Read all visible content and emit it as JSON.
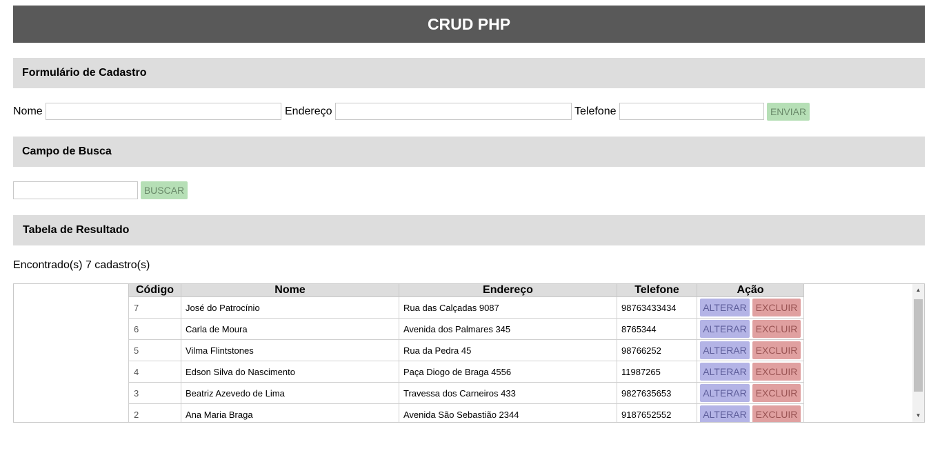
{
  "header": {
    "title": "CRUD PHP"
  },
  "form_section": {
    "title": "Formulário de Cadastro",
    "nome_label": "Nome",
    "nome_value": "",
    "endereco_label": "Endereço",
    "endereco_value": "",
    "telefone_label": "Telefone",
    "telefone_value": "",
    "submit_label": "ENVIAR"
  },
  "search_section": {
    "title": "Campo de Busca",
    "search_value": "",
    "search_button": "BUSCAR"
  },
  "results_section": {
    "title": "Tabela de Resultado",
    "count_text": "Encontrado(s) 7 cadastro(s)",
    "columns": [
      "Código",
      "Nome",
      "Endereço",
      "Telefone",
      "Ação"
    ],
    "rows": [
      {
        "codigo": "7",
        "nome": "José do Patrocínio",
        "endereco": "Rua das Calçadas 9087",
        "telefone": "98763433434",
        "alterar": "ALTERAR",
        "excluir": "EXCLUIR"
      },
      {
        "codigo": "6",
        "nome": "Carla de Moura",
        "endereco": "Avenida dos Palmares 345",
        "telefone": "8765344",
        "alterar": "ALTERAR",
        "excluir": "EXCLUIR"
      },
      {
        "codigo": "5",
        "nome": "Vilma Flintstones",
        "endereco": "Rua da Pedra 45",
        "telefone": "98766252",
        "alterar": "ALTERAR",
        "excluir": "EXCLUIR"
      },
      {
        "codigo": "4",
        "nome": "Edson Silva do Nascimento",
        "endereco": "Paça Diogo de Braga 4556",
        "telefone": "11987265",
        "alterar": "ALTERAR",
        "excluir": "EXCLUIR"
      },
      {
        "codigo": "3",
        "nome": "Beatriz Azevedo de Lima",
        "endereco": "Travessa dos Carneiros 433",
        "telefone": "9827635653",
        "alterar": "ALTERAR",
        "excluir": "EXCLUIR"
      },
      {
        "codigo": "2",
        "nome": "Ana Maria Braga",
        "endereco": "Avenida São Sebastião 2344",
        "telefone": "9187652552",
        "alterar": "ALTERAR",
        "excluir": "EXCLUIR"
      }
    ]
  },
  "colors": {
    "header_bg": "#595959",
    "section_bg": "#dddddd",
    "green_button": "#b6dfb6",
    "alterar_button": "#b4b4e6",
    "excluir_button": "#e0a0a0"
  }
}
